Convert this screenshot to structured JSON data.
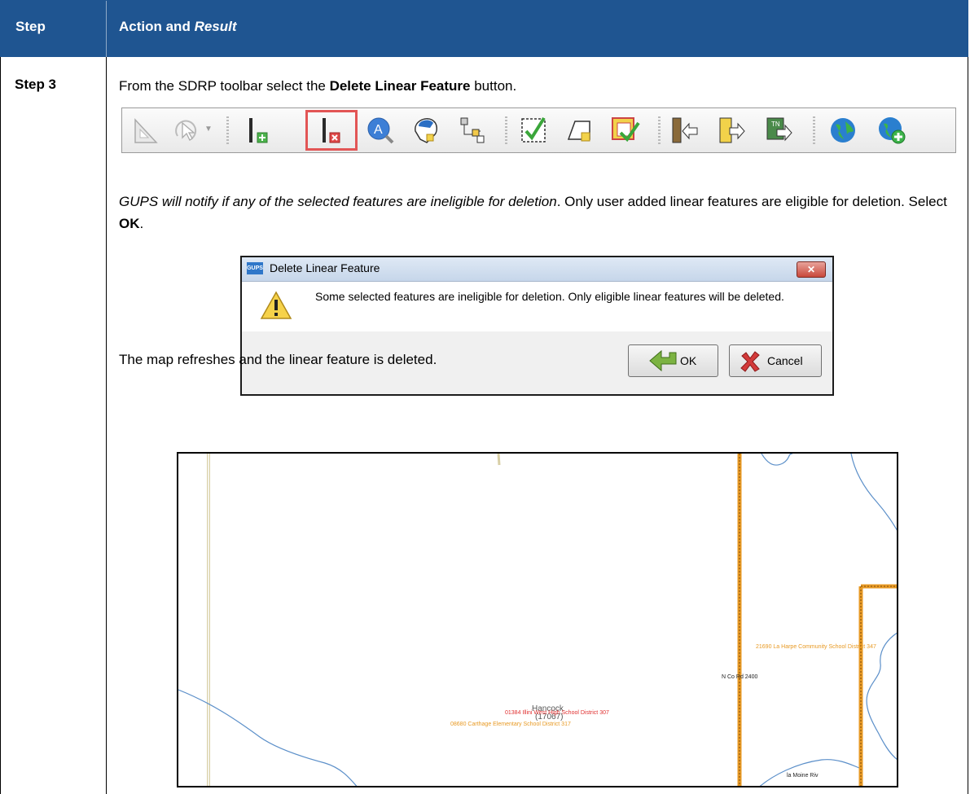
{
  "header": {
    "col1": "Step",
    "col2_action": "Action and ",
    "col2_result": "Result"
  },
  "row": {
    "step": "Step 3",
    "line1_pre": "From the SDRP toolbar select the ",
    "line1_bold": "Delete Linear Feature",
    "line1_post": " button.",
    "line2_italic": "GUPS will notify if any of the selected features are ineligible for deletion",
    "line2_rest": ". Only user added linear features are eligible for deletion. Select ",
    "line2_bold": "OK",
    "line2_end": ".",
    "line3": "The map refreshes and the linear feature is deleted."
  },
  "toolbar": {
    "icons": [
      "measure-icon",
      "select-arrow-icon",
      "add-linear-feature-icon",
      "delete-linear-feature-icon",
      "feature-query-icon",
      "area-landmark-icon",
      "split-icon",
      "validate-icon",
      "add-area-icon",
      "fix-area-icon",
      "import-icon",
      "export-icon",
      "transfer-icon",
      "globe-icon",
      "add-globe-icon"
    ]
  },
  "dialog": {
    "logo": "GUPS",
    "title": "Delete Linear Feature",
    "close": "✕",
    "message": "Some selected features are ineligible for deletion. Only eligible linear features will be deleted.",
    "ok": "OK",
    "cancel": "Cancel"
  },
  "map": {
    "labels": {
      "harpe": "21690 La Harpe Community School District 347",
      "road": "N Co Rd 2400",
      "hancock": "Hancock",
      "fips": "(17067)",
      "illini": "01384 Illini West High School District 307",
      "carthage": "08680 Carthage Elementary School District 317",
      "river": "la Moine Riv"
    },
    "colors": {
      "boundary": "#e89a24",
      "water": "#5b8fc9",
      "road": "#d8cfa6",
      "district_red": "#e03030"
    }
  }
}
